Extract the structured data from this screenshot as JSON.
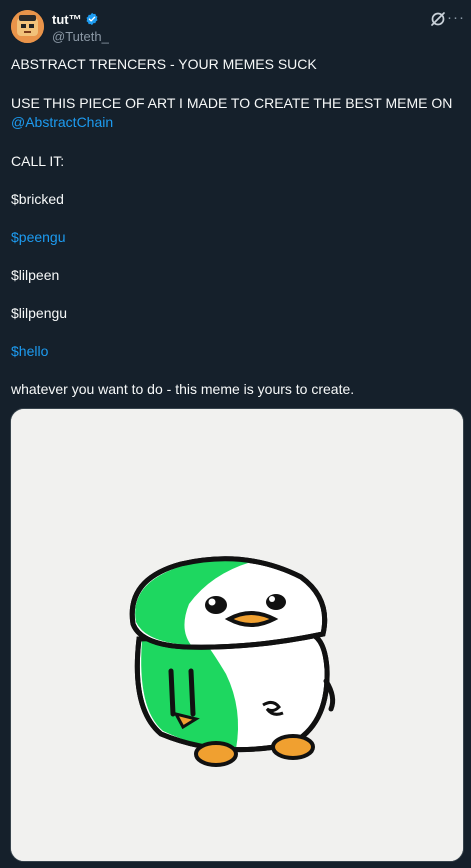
{
  "author": {
    "display_name": "tut™",
    "handle": "@Tuteth_",
    "avatar_icon": "avatar-icon",
    "verified_icon": "verified-badge-icon"
  },
  "actions": {
    "grok_icon": "grok-icon",
    "more_icon": "more-icon",
    "more_label": "···"
  },
  "tweet": {
    "line1": "ABSTRACT TRENCERS - YOUR MEMES SUCK",
    "line2": "USE THIS PIECE OF ART I MADE TO CREATE THE BEST MEME ON",
    "mention": "@AbstractChain",
    "line3": "CALL IT:",
    "tag1": "$bricked",
    "tag2": "$peengu",
    "tag3": "$lilpeen",
    "tag4": "$lilpengu",
    "tag5": "$hello",
    "line4": "whatever you want to do - this meme is yours to create."
  },
  "colors": {
    "background": "#15202b",
    "link": "#1d9bf0",
    "penguin_green": "#1ed760",
    "feet": "#f0a030"
  }
}
